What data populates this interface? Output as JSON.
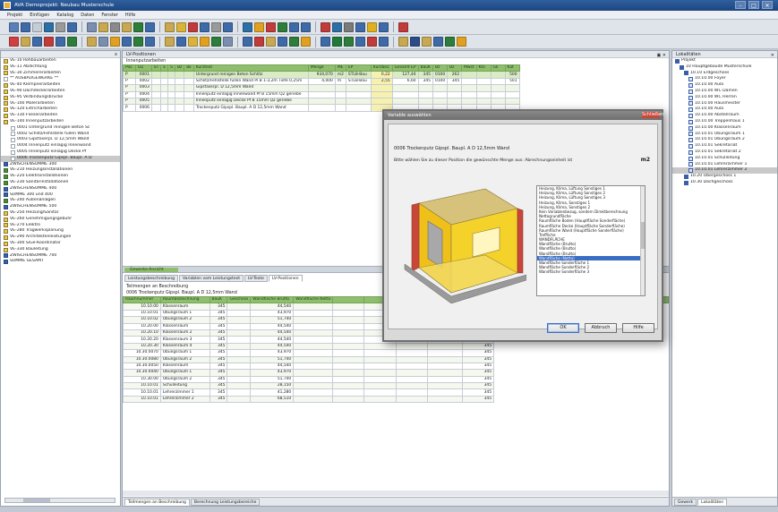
{
  "window": {
    "title": "AVA Demoprojekt: Neubau Musterschule",
    "controls": [
      "–",
      "□",
      "✕"
    ]
  },
  "menu": [
    "Projekt",
    "Einfügen",
    "Katalog",
    "Daten",
    "Fenster",
    "Hilfe"
  ],
  "toolbar1_icons": [
    "#5a7fb8",
    "#3f6aa8",
    "#c4ccd6",
    "#2d6fa5",
    "#9a9a9a",
    "#3f6aa8",
    "#7a8fb0",
    "#c8a850",
    "#8a8a8a",
    "#c8a850",
    "#2e7d3a",
    "#3f6aa8",
    "#c8a850",
    "#d9b33a",
    "#c23b3b",
    "#3f6aa8",
    "#9a9a9a",
    "#3f6aa8",
    "#2d6fa5",
    "#e0a020",
    "#c23b3b",
    "#2e7d3a",
    "#3f6aa8",
    "#3f6aa8",
    "#c23b3b",
    "#2d6fa5",
    "#7a7a7a",
    "#3f6aa8",
    "#e0b020",
    "#3f6aa8",
    "#c23b3b"
  ],
  "toolbar2_icons": [
    "#d04040",
    "#c8a850",
    "#3f6aa8",
    "#c23b3b",
    "#3f6aa8",
    "#2e7d3a",
    "#c8a850",
    "#7a8fb0",
    "#e0a020",
    "#3f6aa8",
    "#2e7d3a",
    "#3f6aa8",
    "#c8a850",
    "#3f6aa8",
    "#d9b33a",
    "#e0a020",
    "#2e7d3a",
    "#7a8fb0",
    "#3f6aa8",
    "#c23b3b",
    "#c8a850",
    "#3f6aa8",
    "#2e7d3a",
    "#e0a020",
    "#3f6aa8",
    "#1f7a3a",
    "#2e7d3a",
    "#3f6aa8",
    "#c23b3b",
    "#3f6aa8",
    "#c8a850",
    "#2a4a88",
    "#c8a850",
    "#3f6aa8",
    "#2e7d3a",
    "#e0a020"
  ],
  "left_tree": {
    "header": "x",
    "items": [
      {
        "t": "VE-10 Rohbauarbeiten",
        "c": "y",
        "i": 0
      },
      {
        "t": "VE-11 Abdichtung",
        "c": "y",
        "i": 0
      },
      {
        "t": "VE-30 Zimmererarbeiten",
        "c": "y",
        "i": 0
      },
      {
        "t": "** AUSBAUGEWERKE **",
        "c": "w",
        "i": 0
      },
      {
        "t": "VE-40 Klempnerarbeiten",
        "c": "y",
        "i": 0
      },
      {
        "t": "VE-90 Dachdeckerarbeiten",
        "c": "y",
        "i": 0
      },
      {
        "t": "VE-95 Verbindungsbrücke",
        "c": "y",
        "i": 0
      },
      {
        "t": "VE-100 Malerarbeiten",
        "c": "y",
        "i": 0
      },
      {
        "t": "VE-120 Estricharbeiten",
        "c": "y",
        "i": 0
      },
      {
        "t": "VE-130 Fliesenarbeiten",
        "c": "y",
        "i": 0
      },
      {
        "t": "VE-140 Innenputzarbeiten",
        "c": "y",
        "i": 0
      },
      {
        "t": "0001 Untergrund reinigen Beton Sc",
        "c": "w",
        "i": 2
      },
      {
        "t": "0002 Schlitz/Fehlstelle füllen Wand",
        "c": "w",
        "i": 2
      },
      {
        "t": "0003 Gipsfaserpl. D 12,5mm Wand",
        "c": "w",
        "i": 2
      },
      {
        "t": "0004 Innenputz einlagig Innenwand",
        "c": "w",
        "i": 2
      },
      {
        "t": "0005 Innenputz einlagig Decke Pf",
        "c": "w",
        "i": 2
      },
      {
        "t": "0006 Trockenputz Gipspl. Baupl. A D",
        "c": "w",
        "i": 2,
        "sel": true
      },
      {
        "t": "ZWISCHENSUMME 300",
        "c": "b",
        "i": 0
      },
      {
        "t": "VE-210 Heizungsinstallationen",
        "c": "g",
        "i": 0
      },
      {
        "t": "VE-220 Elektroinstallationen",
        "c": "g",
        "i": 0
      },
      {
        "t": "VE-230 Sanitärinstallationen",
        "c": "g",
        "i": 0
      },
      {
        "t": "ZWISCHENSUMME 400",
        "c": "b",
        "i": 0
      },
      {
        "t": "SUMME 300 und 400",
        "c": "b",
        "i": 0
      },
      {
        "t": "VE-240 Außenanlagen",
        "c": "g",
        "i": 0
      },
      {
        "t": "ZWISCHENSUMME 500",
        "c": "b",
        "i": 0
      },
      {
        "t": "VE-250 Heizung/Sanitär",
        "c": "y",
        "i": 0
      },
      {
        "t": "VE-260 Genehmigungsgebühr",
        "c": "y",
        "i": 0
      },
      {
        "t": "VE-270 Elektro",
        "c": "y",
        "i": 0
      },
      {
        "t": "VE-280 Tragwerksplanung",
        "c": "y",
        "i": 0
      },
      {
        "t": "VE-290 Architektenleistungen",
        "c": "y",
        "i": 0
      },
      {
        "t": "VE-300 SiGe-Koordinator",
        "c": "y",
        "i": 0
      },
      {
        "t": "VE-330 Bauleitung",
        "c": "y",
        "i": 0
      },
      {
        "t": "ZWISCHENSUMME 700",
        "c": "b",
        "i": 0
      },
      {
        "t": "SUMME GESAMT",
        "c": "b",
        "i": 0
      }
    ]
  },
  "center": {
    "panel_title": "LV-Positionen",
    "sub_label": "Innenputzarbeiten",
    "table1": {
      "headers": [
        "Pos.",
        "OZ",
        "ST",
        "E",
        "S",
        "Bz",
        "Bk",
        "Kurztext",
        "Menge",
        "ME",
        "EP",
        "Kurzbez.",
        "Gesamt EP",
        "BauK",
        "Bz",
        "Bz",
        "Mwst",
        "Kto",
        "Gk",
        "Kat"
      ],
      "rows": [
        [
          "P",
          "0001",
          "",
          "",
          "",
          "",
          "",
          "Untergrund reinigen Beton Schlitz",
          "934,070",
          "m2",
          "STLB-Bau",
          "0,22",
          "127,44",
          "345",
          "0100",
          "262",
          "",
          "",
          "",
          "500"
        ],
        [
          "P",
          "0002",
          "",
          "",
          "",
          "",
          "",
          "Schlitz/Fehlstelle füllen Wand Pl B 1-3,2m Tiefe 0,25m",
          "4,000",
          "m",
          "STLB-Bau",
          "2,55",
          "6,60",
          "345",
          "0100",
          "345",
          "",
          "",
          "",
          "501"
        ],
        [
          "P",
          "0003",
          "",
          "",
          "",
          "",
          "",
          "Gipsfaserpl. D 12,5mm Wand",
          "",
          "",
          "",
          "",
          "",
          "",
          "",
          "",
          "",
          "",
          "",
          ""
        ],
        [
          "P",
          "0004",
          "",
          "",
          "",
          "",
          "",
          "Innenputz einlagig Innenwand Pf B 15mm Q2 geriebe",
          "",
          "",
          "",
          "",
          "",
          "",
          "",
          "",
          "",
          "",
          "",
          ""
        ],
        [
          "P",
          "0005",
          "",
          "",
          "",
          "",
          "",
          "Innenputz einlagig Decke Pf B 15mm Q2 geriebe",
          "",
          "",
          "",
          "",
          "",
          "",
          "",
          "",
          "",
          "",
          "",
          ""
        ],
        [
          "P",
          "0006",
          "",
          "",
          "",
          "",
          "",
          "Trockenputz Gipspl. Baupl. A D 12,5mm Wand",
          "",
          "",
          "",
          "",
          "",
          "",
          "",
          "",
          "",
          "",
          "",
          ""
        ]
      ]
    },
    "divider_label": "Gewerke-Ansicht",
    "tabs": [
      "Leistungsbeschreibung",
      "Variablen vom Leistungstext",
      "LV-Texte",
      "LV-Positionen"
    ],
    "takeoff_title": "Teilmengen an Beschreibung",
    "takeoff_sub": "0006 Trockenputz Gipspl. Baupl. A D 12,5mm Wand",
    "table2": {
      "headers": [
        "Raumnummer",
        "Raumbezeichnung",
        "BauK",
        "Geschoss",
        "Wandfläche Brutto",
        "Wandfläche Netto",
        "",
        "",
        "",
        "",
        "BauK",
        "",
        "",
        "",
        "",
        ""
      ],
      "rows": [
        [
          "10.10.00",
          "Klassenraum",
          "345",
          "",
          "44,540",
          "",
          "",
          "",
          "",
          "",
          "345"
        ],
        [
          "10.10.01",
          "Übungsraum 1",
          "345",
          "",
          "43,970",
          "",
          "",
          "",
          "",
          "",
          "345"
        ],
        [
          "10.10.02",
          "Übungsraum 2",
          "345",
          "",
          "51,740",
          "",
          "",
          "",
          "",
          "",
          "345"
        ],
        [
          "10.20.00",
          "Klassenraum",
          "345",
          "",
          "44,540",
          "",
          "",
          "",
          "",
          "",
          "345"
        ],
        [
          "10.20.10",
          "Klassenraum 2",
          "345",
          "",
          "44,540",
          "",
          "",
          "",
          "",
          "",
          "345"
        ],
        [
          "10.20.20",
          "Klassenraum 3",
          "345",
          "",
          "44,540",
          "",
          "",
          "",
          "",
          "",
          "345"
        ],
        [
          "10.20.30",
          "Klassenraum 4",
          "345",
          "",
          "44,540",
          "",
          "",
          "",
          "",
          "",
          "345"
        ],
        [
          "10.30.0070",
          "Übungsraum 1",
          "345",
          "",
          "43,970",
          "",
          "",
          "",
          "",
          "",
          "345"
        ],
        [
          "10.30.0080",
          "Übungsraum 2",
          "345",
          "",
          "51,740",
          "",
          "",
          "",
          "",
          "",
          "345"
        ],
        [
          "10.30.0050",
          "Klassenraum",
          "345",
          "",
          "44,540",
          "",
          "",
          "",
          "",
          "",
          "345"
        ],
        [
          "10.30.0040",
          "Übungsraum 1",
          "345",
          "",
          "43,970",
          "",
          "",
          "",
          "",
          "",
          "345"
        ],
        [
          "10.30.00",
          "Übungsraum 2",
          "345",
          "",
          "51,740",
          "",
          "",
          "",
          "",
          "",
          "345"
        ],
        [
          "10.10.01",
          "Schulleitung",
          "345",
          "",
          "28,150",
          "",
          "",
          "",
          "",
          "",
          "345"
        ],
        [
          "10.10.01",
          "Lehrerzimmer 1",
          "345",
          "",
          "41,280",
          "",
          "",
          "",
          "",
          "",
          "345"
        ],
        [
          "10.10.01",
          "Lehrerzimmer 2",
          "345",
          "",
          "68,510",
          "",
          "",
          "",
          "",
          "",
          "345"
        ]
      ]
    },
    "bottom_tabs": [
      "Teilmengen an Beschreibung",
      "Berechnung Leistungsbereiche"
    ]
  },
  "right_tree": {
    "header": "Lokalitäten",
    "items": [
      {
        "t": "Projekt",
        "i": 0,
        "c": "b"
      },
      {
        "t": "10 Hauptgebäude Musterschule",
        "i": 1,
        "c": "b"
      },
      {
        "t": "10.10 Erdgeschoss",
        "i": 2,
        "c": "b"
      },
      {
        "t": "10.10.00 Foyer",
        "i": 3
      },
      {
        "t": "10.10.00 Aula",
        "i": 3
      },
      {
        "t": "10.10.00 WC Damen",
        "i": 3
      },
      {
        "t": "10.10.00 WC Herren",
        "i": 3
      },
      {
        "t": "10.10.00 Hausmeister",
        "i": 3
      },
      {
        "t": "10.10.00 Aula",
        "i": 3
      },
      {
        "t": "10.10.00 Abstellraum",
        "i": 3
      },
      {
        "t": "10.10.00 Treppenhaus 1",
        "i": 3
      },
      {
        "t": "10.10.00 Klassenraum",
        "i": 3
      },
      {
        "t": "10.10.01 Übungsraum 1",
        "i": 3
      },
      {
        "t": "10.10.01 Übungsraum 2",
        "i": 3
      },
      {
        "t": "10.10.01 Sekretariat",
        "i": 3
      },
      {
        "t": "10.10.01 Sekretariat 2",
        "i": 3
      },
      {
        "t": "10.10.01 Schulleitung",
        "i": 3
      },
      {
        "t": "10.10.01 Lehrerzimmer 1",
        "i": 3
      },
      {
        "t": "10.10.01 Lehrerzimmer 2",
        "i": 3,
        "sel": true
      },
      {
        "t": "10.20 Obergeschoss 1",
        "i": 2,
        "c": "b"
      },
      {
        "t": "10.30 Dachgeschoss",
        "i": 2,
        "c": "b"
      }
    ],
    "tabs": [
      "Gewerk",
      "Lokalitäten"
    ]
  },
  "dialog": {
    "title": "Variable auswählen",
    "close": "Schließen",
    "position": "0006 Trockenputz Gipspl. Baupl. A D 12,5mm Wand",
    "instruction": "Bitte wählen Sie zu dieser Position die gewünschte Menge aus: Abrechnungseinheit ist",
    "unit": "m2",
    "list": [
      "Heizung, Klima, Lüftung Sonstiges 1",
      "Heizung, Klima, Lüftung Sonstiges 2",
      "Heizung, Klima, Lüftung Sonstiges 3",
      "Heizung, Klima, Sonstiges 1",
      "Heizung, Klima, Sonstiges 2",
      "Kein Variablenbezug, sondern Direktberechnung",
      "Nettogrundfläche",
      "Raumfläche Boden (Hauptfläche Sonderfläche)",
      "Raumfläche Decke (Hauptfläche Sonderfläche)",
      "Raumfläche Wand (Hauptfläche Sonderfläche)",
      "Treffliche",
      "WANDFLÄCHE",
      "Wandfläche (Brutto)",
      "Wandfläche (Brutto)",
      "Wandfläche (Brutto)",
      "Wandfläche (Netto)",
      "Wandfläche Sonderfläche 1",
      "Wandfläche Sonderfläche 2",
      "Wandfläche Sonderfläche 3"
    ],
    "selected_index": 15,
    "buttons": {
      "ok": "OK",
      "cancel": "Abbruch",
      "help": "Hilfe"
    }
  }
}
